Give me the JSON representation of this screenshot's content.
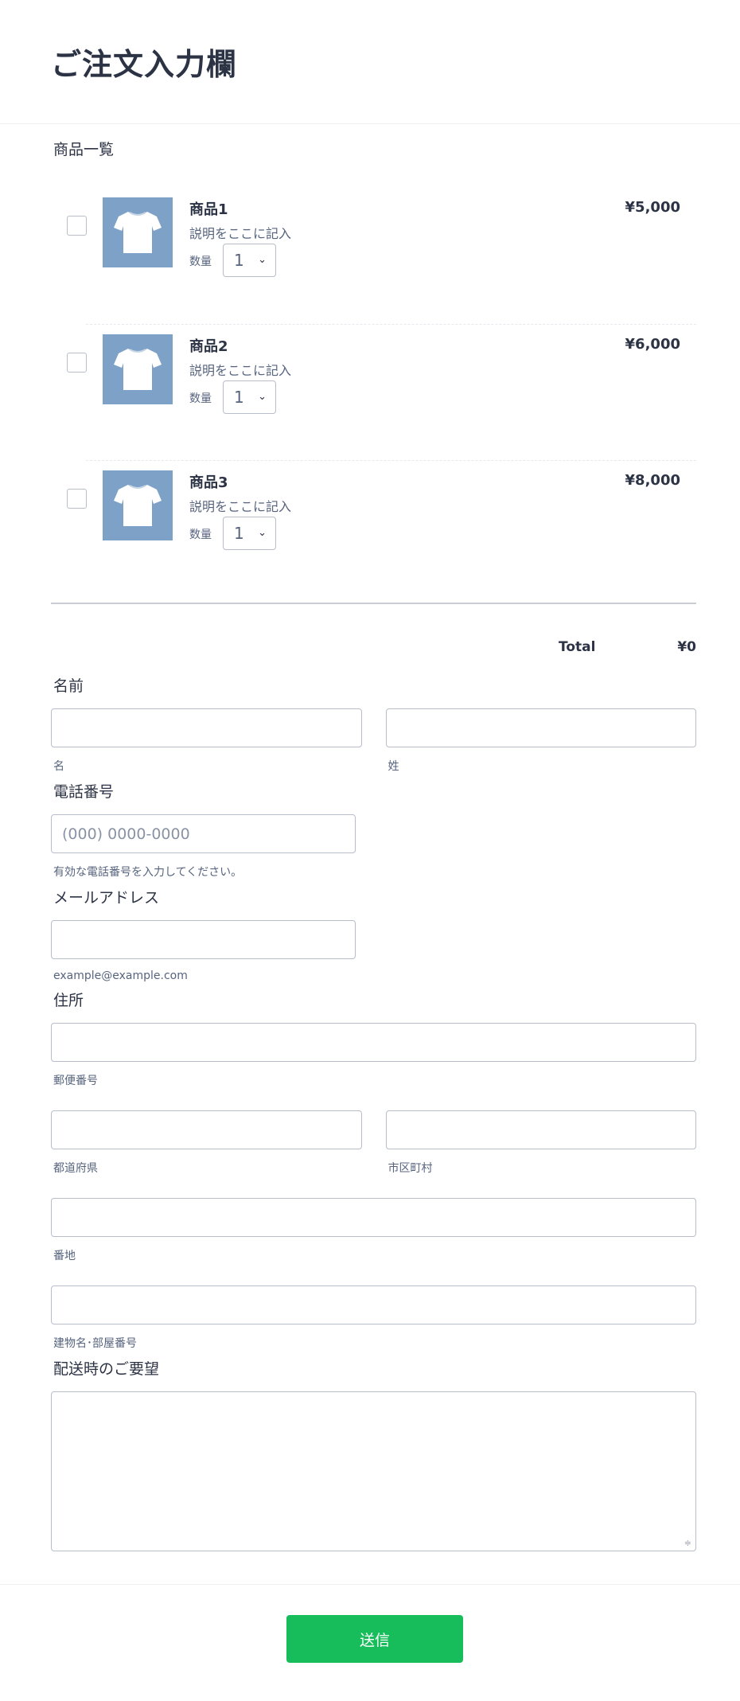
{
  "header": {
    "title": "ご注文入力欄"
  },
  "products": {
    "label": "商品一覧",
    "items": [
      {
        "name": "商品1",
        "description": "説明をここに記入",
        "qty_label": "数量",
        "qty": "1",
        "price": "¥5,000"
      },
      {
        "name": "商品2",
        "description": "説明をここに記入",
        "qty_label": "数量",
        "qty": "1",
        "price": "¥6,000"
      },
      {
        "name": "商品3",
        "description": "説明をここに記入",
        "qty_label": "数量",
        "qty": "1",
        "price": "¥8,000"
      }
    ],
    "total_label": "Total",
    "total_value": "¥0"
  },
  "form": {
    "name": {
      "label": "名前",
      "first_sublabel": "名",
      "last_sublabel": "姓"
    },
    "phone": {
      "label": "電話番号",
      "placeholder": "(000) 0000-0000",
      "hint": "有効な電話番号を入力してください。"
    },
    "email": {
      "label": "メールアドレス",
      "hint": "example@example.com"
    },
    "address": {
      "label": "住所",
      "postal": "郵便番号",
      "prefecture": "都道府県",
      "city": "市区町村",
      "street": "番地",
      "building": "建物名･部屋番号"
    },
    "delivery": {
      "label": "配送時のご要望"
    }
  },
  "footer": {
    "submit_label": "送信"
  },
  "colors": {
    "submit_bg": "#18bd5b",
    "thumb_bg": "#7ea2c7",
    "text": "#2c3345"
  },
  "icons": {
    "thumb": "tshirt-icon",
    "select": "chevron-down-icon"
  }
}
